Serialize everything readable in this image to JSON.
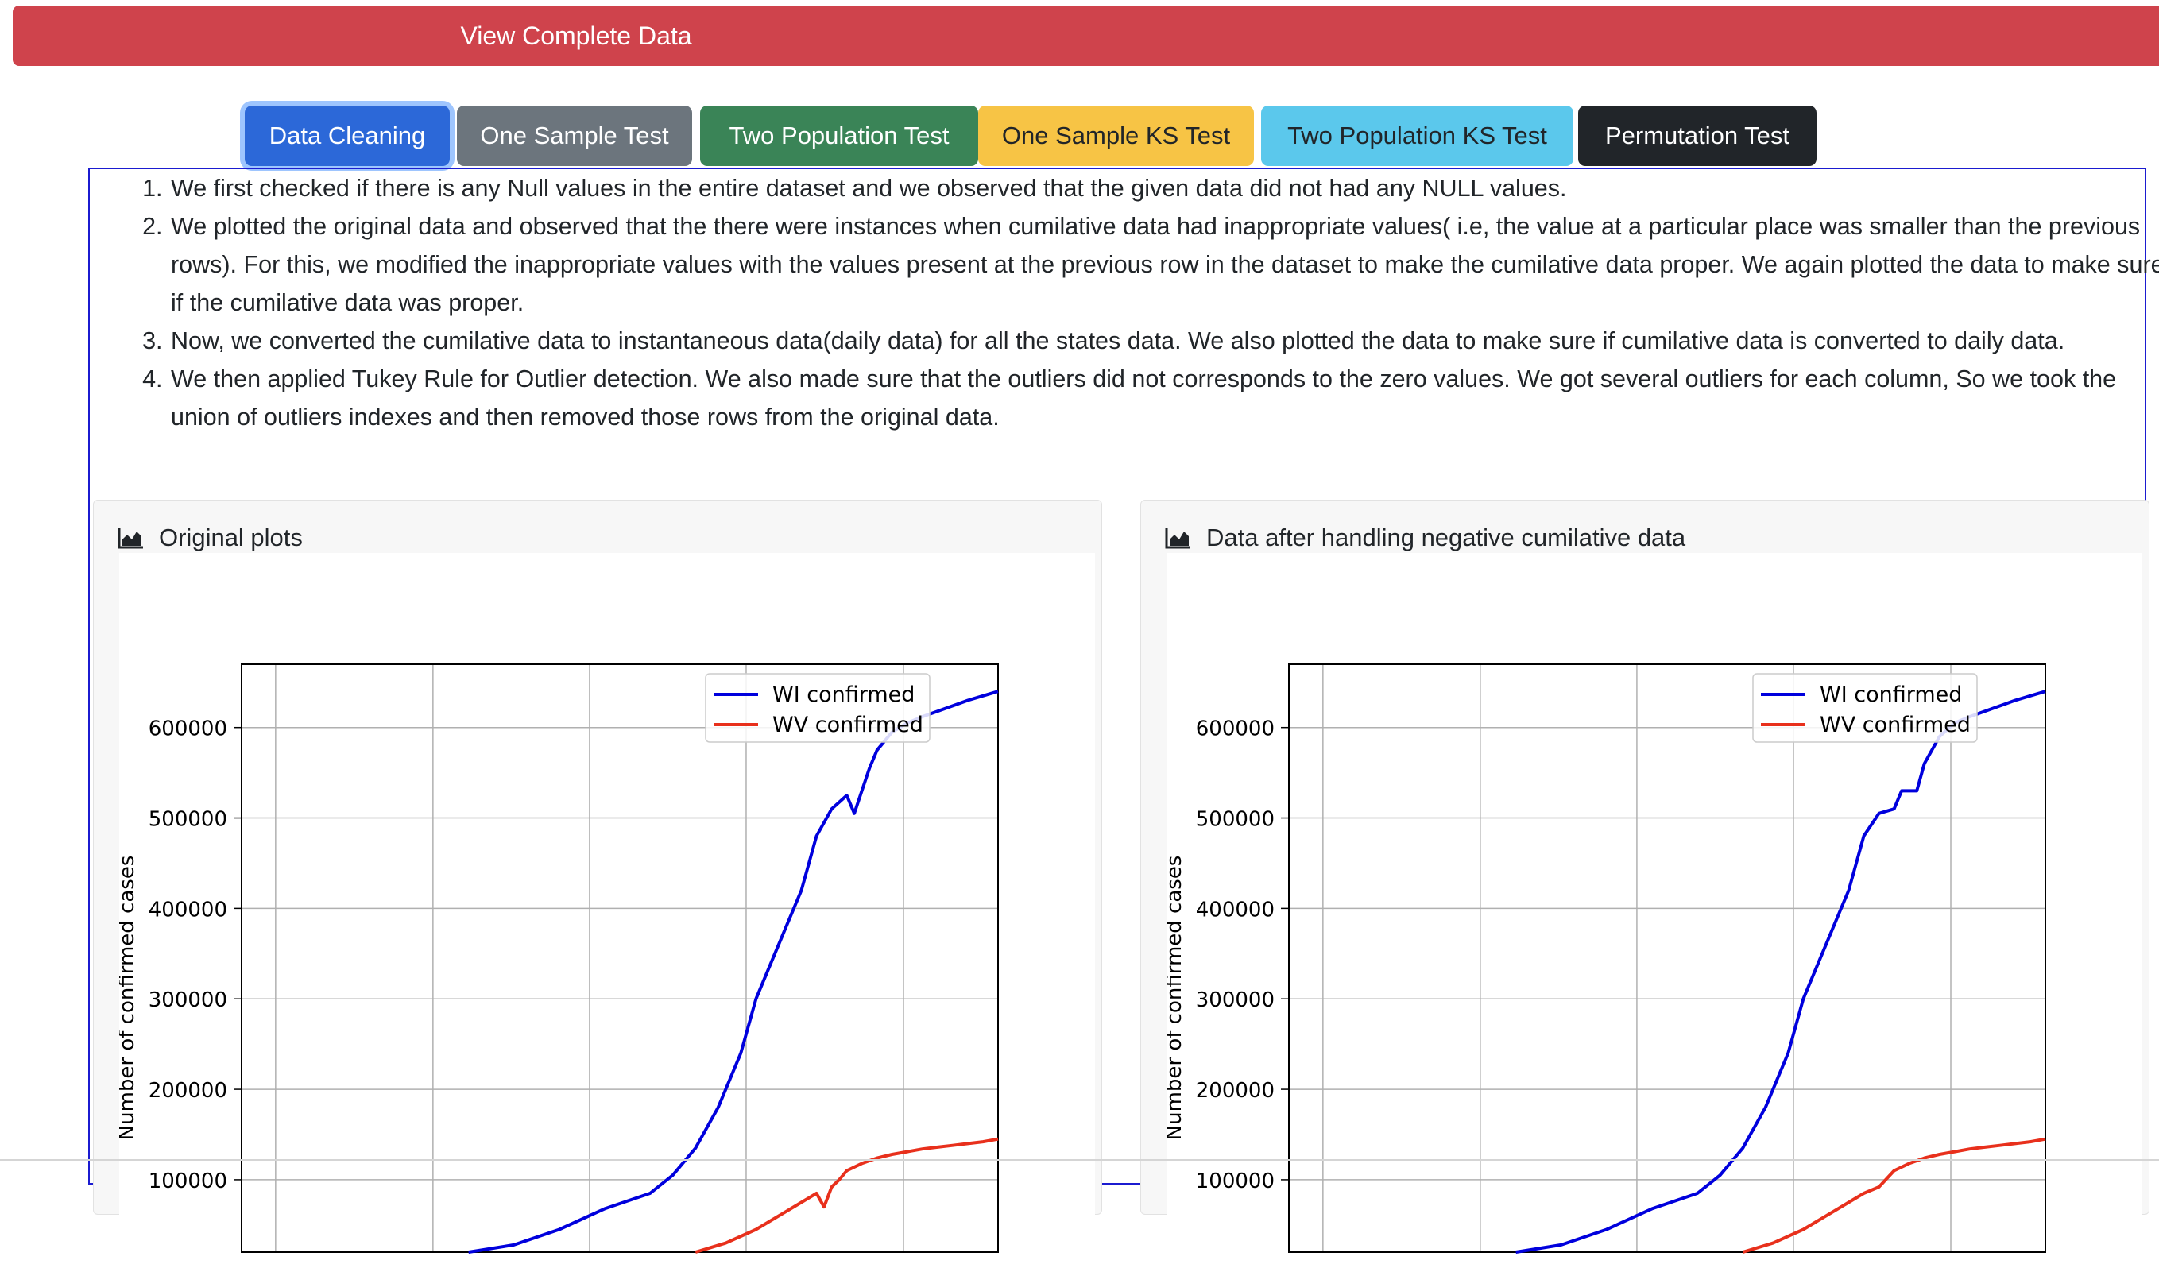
{
  "header": {
    "view_complete_label": "View Complete Data"
  },
  "tabs": [
    {
      "label": "Data Cleaning",
      "bg": "#2c68d8",
      "fg": "#ffffff"
    },
    {
      "label": "One Sample Test",
      "bg": "#6c757d",
      "fg": "#ffffff"
    },
    {
      "label": "Two Population Test",
      "bg": "#3a8457",
      "fg": "#ffffff"
    },
    {
      "label": "One Sample KS Test",
      "bg": "#f7c445",
      "fg": "#212529"
    },
    {
      "label": "Two Population KS Test",
      "bg": "#5bc8ec",
      "fg": "#212529"
    },
    {
      "label": "Permutation Test",
      "bg": "#212529",
      "fg": "#ffffff"
    }
  ],
  "steps": [
    "We first checked if there is any Null values in the entire dataset and we observed that the given data did not had any NULL values.",
    "We plotted the original data and observed that the there were instances when cumilative data had inappropriate values( i.e, the value at a particular place was smaller than the previous rows). For this, we modified the inappropriate values with the values present at the previous row in the dataset to make the cumilative data proper. We again plotted the data to make sure if the cumilative data was proper.",
    "Now, we converted the cumilative data to instantaneous data(daily data) for all the states data. We also plotted the data to make sure if cumilative data is converted to daily data.",
    "We then applied Tukey Rule for Outlier detection. We also made sure that the outliers did not corresponds to the zero values. We got several outliers for each column, So we took the union of outliers indexes and then removed those rows from the original data."
  ],
  "cards": [
    {
      "title": "Original plots",
      "icon": "area-chart-icon"
    },
    {
      "title": "Data after handling negative cumilative data",
      "icon": "area-chart-icon"
    }
  ],
  "colors": {
    "wi": "#0000dd",
    "wv": "#e8301c"
  },
  "chart_data": [
    {
      "type": "line",
      "ylabel": "Number of confirmed cases",
      "yticks": [
        100000,
        200000,
        300000,
        400000,
        500000,
        600000
      ],
      "ylim": [
        20000,
        670000
      ],
      "xlim": [
        0,
        1
      ],
      "grid": true,
      "legend": "top-right",
      "series": [
        {
          "name": "WI confirmed",
          "color": "#0000dd",
          "x": [
            0.3,
            0.36,
            0.42,
            0.48,
            0.54,
            0.57,
            0.6,
            0.63,
            0.66,
            0.68,
            0.7,
            0.72,
            0.74,
            0.75,
            0.76,
            0.78,
            0.8,
            0.81,
            0.82,
            0.83,
            0.84,
            0.86,
            0.88,
            0.9,
            0.92,
            0.94,
            0.96,
            0.98,
            1.0
          ],
          "y": [
            20000,
            28000,
            45000,
            68000,
            85000,
            105000,
            135000,
            180000,
            240000,
            300000,
            340000,
            380000,
            420000,
            450000,
            480000,
            510000,
            525000,
            505000,
            530000,
            555000,
            575000,
            595000,
            605000,
            612000,
            618000,
            624000,
            630000,
            635000,
            640000
          ]
        },
        {
          "name": "WV confirmed",
          "color": "#e8301c",
          "x": [
            0.6,
            0.64,
            0.68,
            0.72,
            0.74,
            0.76,
            0.77,
            0.78,
            0.79,
            0.8,
            0.82,
            0.84,
            0.86,
            0.88,
            0.9,
            0.92,
            0.94,
            0.96,
            0.98,
            1.0
          ],
          "y": [
            20000,
            30000,
            45000,
            65000,
            75000,
            85000,
            70000,
            92000,
            100000,
            110000,
            118000,
            124000,
            128000,
            131000,
            134000,
            136000,
            138000,
            140000,
            142000,
            145000
          ]
        }
      ]
    },
    {
      "type": "line",
      "ylabel": "Number of confirmed cases",
      "yticks": [
        100000,
        200000,
        300000,
        400000,
        500000,
        600000
      ],
      "ylim": [
        20000,
        670000
      ],
      "xlim": [
        0,
        1
      ],
      "grid": true,
      "legend": "top-right",
      "series": [
        {
          "name": "WI confirmed",
          "color": "#0000dd",
          "x": [
            0.3,
            0.36,
            0.42,
            0.48,
            0.54,
            0.57,
            0.6,
            0.63,
            0.66,
            0.68,
            0.7,
            0.72,
            0.74,
            0.75,
            0.76,
            0.78,
            0.8,
            0.81,
            0.83,
            0.84,
            0.86,
            0.88,
            0.9,
            0.92,
            0.94,
            0.96,
            0.98,
            1.0
          ],
          "y": [
            20000,
            28000,
            45000,
            68000,
            85000,
            105000,
            135000,
            180000,
            240000,
            300000,
            340000,
            380000,
            420000,
            450000,
            480000,
            505000,
            510000,
            530000,
            530000,
            560000,
            590000,
            605000,
            612000,
            618000,
            624000,
            630000,
            635000,
            640000
          ]
        },
        {
          "name": "WV confirmed",
          "color": "#e8301c",
          "x": [
            0.6,
            0.64,
            0.68,
            0.72,
            0.74,
            0.76,
            0.78,
            0.8,
            0.82,
            0.84,
            0.86,
            0.88,
            0.9,
            0.92,
            0.94,
            0.96,
            0.98,
            1.0
          ],
          "y": [
            20000,
            30000,
            45000,
            65000,
            75000,
            85000,
            92000,
            110000,
            118000,
            124000,
            128000,
            131000,
            134000,
            136000,
            138000,
            140000,
            142000,
            145000
          ]
        }
      ]
    }
  ]
}
